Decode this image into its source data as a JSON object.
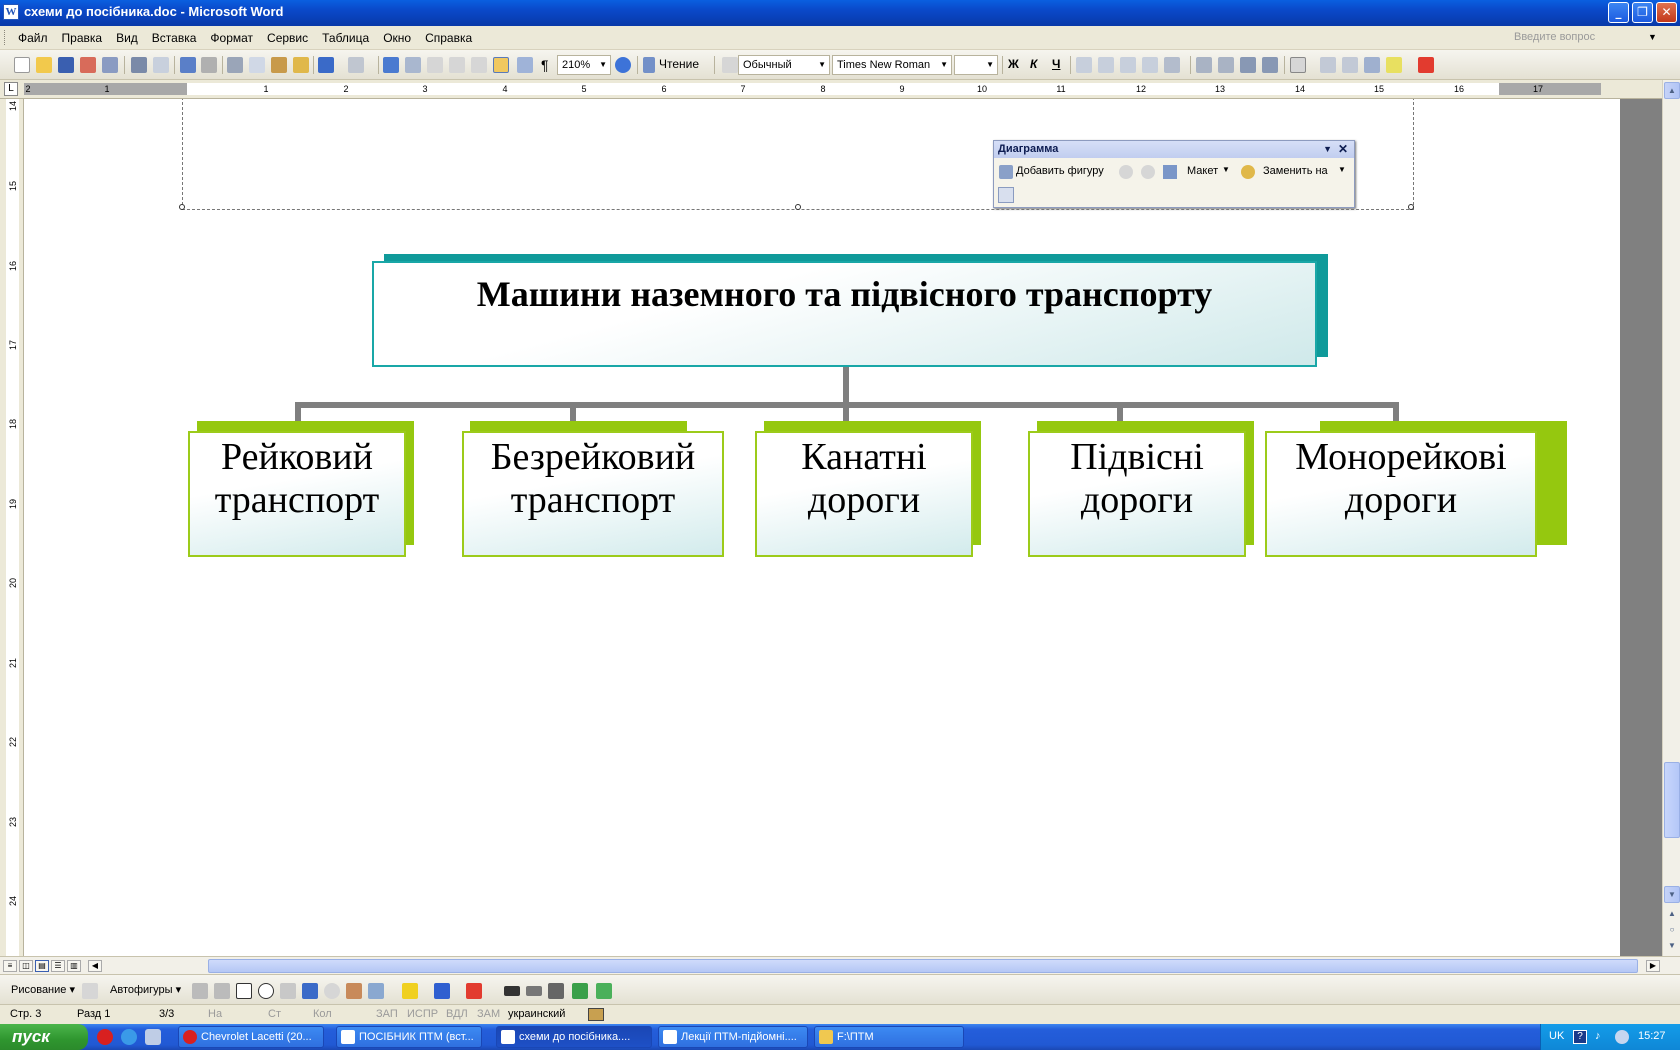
{
  "window": {
    "title": "схеми до посібника.doc - Microsoft Word",
    "minimize": "_",
    "maximize": "❐",
    "close": "✕"
  },
  "menu": {
    "items": [
      "Файл",
      "Правка",
      "Вид",
      "Вставка",
      "Формат",
      "Сервис",
      "Таблица",
      "Окно",
      "Справка"
    ],
    "help_placeholder": "Введите вопрос"
  },
  "toolbar": {
    "zoom": "210%",
    "reading_label": "Чтение",
    "style": "Обычный",
    "font": "Times New Roman",
    "font_size": "",
    "bold": "Ж",
    "italic": "К",
    "underline": "Ч",
    "pilcrow": "¶"
  },
  "ruler": {
    "marks": [
      "2",
      "1",
      "1",
      "2",
      "3",
      "4",
      "5",
      "6",
      "7",
      "8",
      "9",
      "10",
      "11",
      "12",
      "13",
      "14",
      "15",
      "16",
      "17"
    ],
    "vertical_marks": [
      "14",
      "15",
      "16",
      "17",
      "18",
      "19",
      "20",
      "21",
      "22",
      "23",
      "24"
    ]
  },
  "diagram_toolbar": {
    "title": "Диаграмма",
    "add_shape": "Добавить фигуру",
    "layout": "Макет",
    "change_to": "Заменить на"
  },
  "org_chart": {
    "root": "Машини наземного та підвісного транспорту",
    "children": [
      "Рейковий\nтранспорт",
      "Безрейковий\nтранспорт",
      "Канатні\nдороги",
      "Підвісні\nдороги",
      "Монорейкові\nдороги"
    ],
    "colors": {
      "root_border": "#19a7a7",
      "root_shadow": "#0f9a9a",
      "child_border": "#9ccb1a",
      "child_shadow": "#95c80f",
      "connector": "#7f7f7f"
    }
  },
  "drawing_toolbar": {
    "drawing": "Рисование",
    "autoshapes": "Автофигуры"
  },
  "status": {
    "page": "Стр. 3",
    "section": "Разд 1",
    "pages": "3/3",
    "at": "На",
    "line": "Ст",
    "col": "Кол",
    "rec": "ЗАП",
    "trk": "ИСПР",
    "ext": "ВДЛ",
    "ovr": "ЗАМ",
    "language": "украинский"
  },
  "taskbar": {
    "start": "пуск",
    "tasks": [
      "Chevrolet Lacetti (20...",
      "ПОСІБНИК ПТМ (вст...",
      "схеми до посібника....",
      "Лекції ПТМ-підйомні....",
      "F:\\ПТМ"
    ],
    "lang": "UK",
    "time": "15:27"
  }
}
